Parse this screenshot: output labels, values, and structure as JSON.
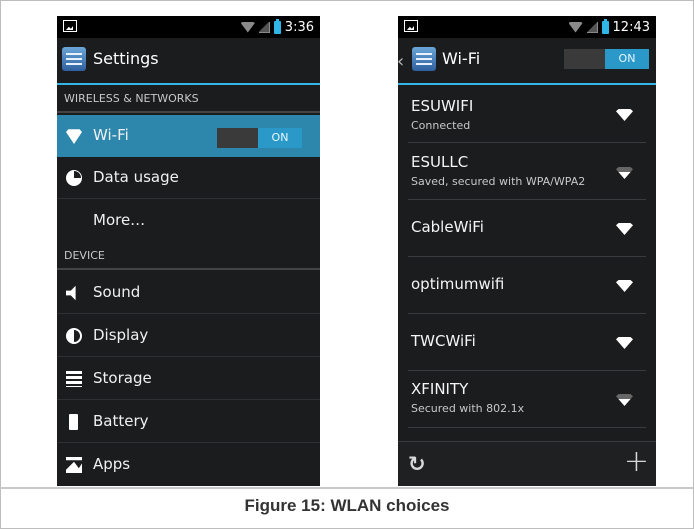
{
  "caption": "Figure 15: WLAN choices",
  "left_phone": {
    "status_time": "3:36",
    "title": "Settings",
    "section_wireless": "WIRELESS & NETWORKS",
    "wifi_label": "Wi-Fi",
    "wifi_toggle": "ON",
    "data_usage_label": "Data usage",
    "more_label": "More…",
    "section_device": "DEVICE",
    "sound_label": "Sound",
    "display_label": "Display",
    "storage_label": "Storage",
    "battery_label": "Battery",
    "apps_label": "Apps"
  },
  "right_phone": {
    "status_time": "12:43",
    "title": "Wi-Fi",
    "toggle": "ON",
    "networks": [
      {
        "name": "ESUWIFI",
        "status": "Connected",
        "signal": "strong-locked"
      },
      {
        "name": "ESULLC",
        "status": "Saved, secured with WPA/WPA2",
        "signal": "weak-locked"
      },
      {
        "name": "CableWiFi",
        "status": "",
        "signal": "strong"
      },
      {
        "name": "optimumwifi",
        "status": "",
        "signal": "strong"
      },
      {
        "name": "TWCWiFi",
        "status": "",
        "signal": "strong"
      },
      {
        "name": "XFINITY",
        "status": "Secured with 802.1x",
        "signal": "weak-locked"
      }
    ],
    "scan_icon": "refresh-icon",
    "add_icon": "plus-icon"
  },
  "colors": {
    "accent": "#33b5e5",
    "selected_row": "#2d87ad",
    "background": "#1b1c1e"
  }
}
